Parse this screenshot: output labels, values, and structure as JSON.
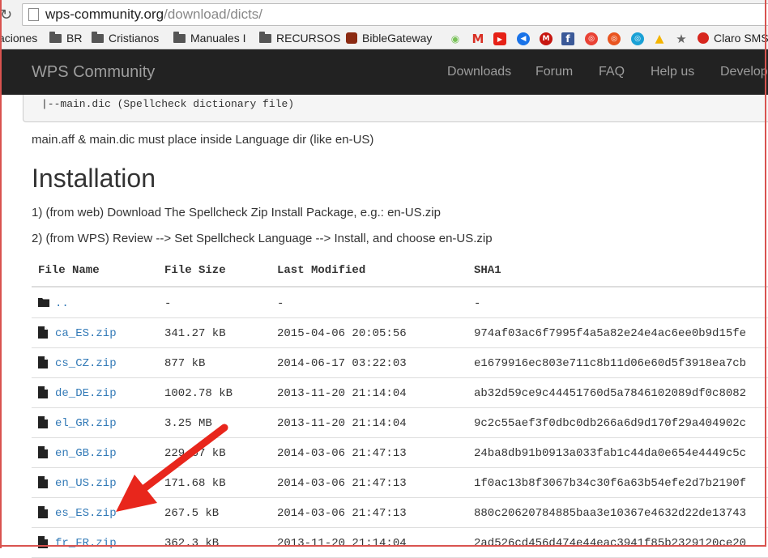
{
  "browser": {
    "url_host": "wps-community.org",
    "url_path": "/download/dicts/",
    "bookmarks": [
      {
        "label": "aciones",
        "icon": "folder-icon"
      },
      {
        "label": "BR",
        "icon": "folder-icon"
      },
      {
        "label": "Cristianos",
        "icon": "folder-icon"
      },
      {
        "label": "Manuales I",
        "icon": "folder-icon"
      },
      {
        "label": "RECURSOS",
        "icon": "folder-icon"
      },
      {
        "label": "BibleGateway",
        "icon": "bible-icon"
      },
      {
        "label": "Claro SMS",
        "icon": "claro-icon"
      }
    ]
  },
  "nav": {
    "brand": "WPS Community",
    "links": [
      "Downloads",
      "Forum",
      "FAQ",
      "Help us",
      "Develop"
    ]
  },
  "content": {
    "pre_text": "|--main.dic (Spellcheck dictionary file)",
    "note": "main.aff & main.dic must place inside Language dir (like en-US)",
    "heading": "Installation",
    "step1": "1) (from web) Download The Spellcheck Zip Install Package, e.g.: en-US.zip",
    "step2": "2) (from WPS) Review --> Set Spellcheck Language --> Install, and choose en-US.zip"
  },
  "table": {
    "headers": [
      "File Name",
      "File Size",
      "Last Modified",
      "SHA1"
    ],
    "rows": [
      {
        "name": "..",
        "size": "-",
        "modified": "-",
        "sha1": "-",
        "type": "folder"
      },
      {
        "name": "ca_ES.zip",
        "size": "341.27 kB",
        "modified": "2015-04-06 20:05:56",
        "sha1": "974af03ac6f7995f4a5a82e24e4ac6ee0b9d15fe",
        "type": "file"
      },
      {
        "name": "cs_CZ.zip",
        "size": "877 kB",
        "modified": "2014-06-17 03:22:03",
        "sha1": "e1679916ec803e711c8b11d06e60d5f3918ea7cb",
        "type": "file"
      },
      {
        "name": "de_DE.zip",
        "size": "1002.78 kB",
        "modified": "2013-11-20 21:14:04",
        "sha1": "ab32d59ce9c44451760d5a7846102089df0c8082",
        "type": "file"
      },
      {
        "name": "el_GR.zip",
        "size": "3.25 MB",
        "modified": "2013-11-20 21:14:04",
        "sha1": "9c2c55aef3f0dbc0db266a6d9d170f29a404902c",
        "type": "file"
      },
      {
        "name": "en_GB.zip",
        "size": "229.67 kB",
        "modified": "2014-03-06 21:47:13",
        "sha1": "24ba8db91b0913a033fab1c44da0e654e4449c5c",
        "type": "file"
      },
      {
        "name": "en_US.zip",
        "size": "171.68 kB",
        "modified": "2014-03-06 21:47:13",
        "sha1": "1f0ac13b8f3067b34c30f6a63b54efe2d7b2190f",
        "type": "file"
      },
      {
        "name": "es_ES.zip",
        "size": "267.5 kB",
        "modified": "2014-03-06 21:47:13",
        "sha1": "880c20620784885baa3e10367e4632d22de13743",
        "type": "file"
      },
      {
        "name": "fr_FR.zip",
        "size": "362.3 kB",
        "modified": "2013-11-20 21:14:04",
        "sha1": "2ad526cd456d474e44eac3941f85b2329120ce20",
        "type": "file"
      }
    ]
  },
  "colors": {
    "navbar": "#222222",
    "link": "#337ab7",
    "annotation_arrow": "#e8261c"
  }
}
